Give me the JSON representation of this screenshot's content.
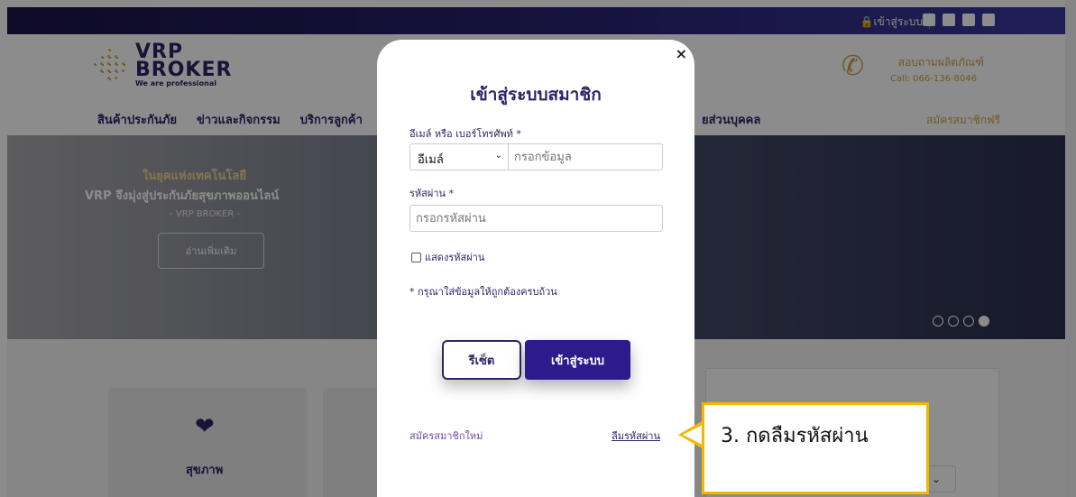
{
  "topbar": {
    "login_label": "เข้าสู่ระบบ",
    "social_icons": [
      "line-icon",
      "facebook-icon",
      "email-icon",
      "tiktok-icon"
    ]
  },
  "header": {
    "logo_line1": "VRP",
    "logo_line2": "BROKER",
    "logo_tagline": "We are professional",
    "contact_title": "สอบถามผลิตภัณฑ์",
    "contact_call": "Call: 066-136-8046",
    "nav": [
      "สินค้าประกันภัย",
      "ข่าวและกิจกรรม",
      "บริการลูกค้า"
    ],
    "nav_right": "ยส่วนบุคคล",
    "register_label": "สมัครสมาชิกฟรี"
  },
  "hero": {
    "line1": "ในยุคแห่งเทคโนโลยี",
    "line2": "VRP จึงมุ่งสู่ประกันภัยสุขภาพออนไลน์",
    "line3": "- VRP BROKER -",
    "button": "อ่านเพิ่มเติม",
    "slides": 4,
    "active_slide": 4
  },
  "cards": {
    "health_label": "สุขภาพ"
  },
  "modal": {
    "title": "เข้าสู่ระบบสมาชิก",
    "email_label": "อีเมล์ หรือ เบอร์โทรศัพท์ *",
    "type_selected": "อีเมล์",
    "email_placeholder": "กรอกข้อมูล",
    "password_label": "รหัสผ่าน *",
    "password_placeholder": "กรอกรหัสผ่าน",
    "show_password": "แสดงรหัสผ่าน",
    "hint": "* กรุณาใส่ข้อมูลให้ถูกต้องครบถ้วน",
    "reset_button": "รีเซ็ต",
    "login_button": "เข้าสู่ระบบ",
    "register_link": "สมัครสมาชิกใหม่",
    "forgot_link": "ลืมรหัสผ่าน",
    "close": "×"
  },
  "callout": {
    "text": "3. กดลืมรหัสผ่าน"
  },
  "colors": {
    "brand_navy": "#2d2466",
    "gold": "#c9a54a",
    "login_purple": "#2d1a8c",
    "callout_border": "#f2b800"
  }
}
